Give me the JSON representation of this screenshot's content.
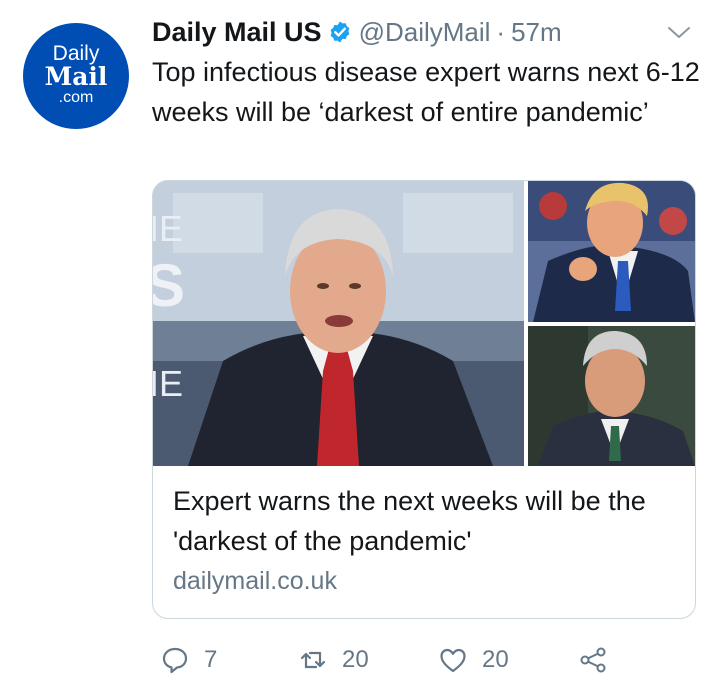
{
  "account": {
    "avatar": {
      "line1": "Daily",
      "line2": "Mail",
      "line3": ".com"
    },
    "name": "Daily Mail US",
    "handle": "@DailyMail",
    "separator": "·",
    "time": "57m",
    "verified": true
  },
  "tweet": {
    "text": "Top infectious disease expert warns next 6-12 weeks will be ‘darkest of entire pandemic’"
  },
  "card": {
    "title": "Expert warns the next weeks will be the 'darkest of the pandemic'",
    "domain": "dailymail.co.uk",
    "images": [
      "expert-interview-photo",
      "man-pointing-photo",
      "gray-haired-man-photo"
    ]
  },
  "actions": {
    "reply_count": "7",
    "retweet_count": "20",
    "like_count": "20"
  },
  "colors": {
    "avatar_bg": "#004db3",
    "verified": "#1da1f2",
    "secondary_text": "#657786",
    "border": "#ccd6dd"
  }
}
